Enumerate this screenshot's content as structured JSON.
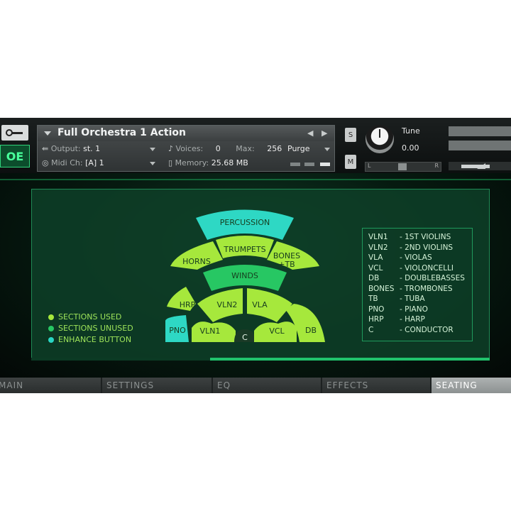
{
  "header": {
    "instrument_name": "Full Orchestra 1 Action",
    "output_label": "Output:",
    "output_value": "st. 1",
    "voices_label": "Voices:",
    "voices_value": "0",
    "max_label": "Max:",
    "max_value": "256",
    "purge_label": "Purge",
    "midi_label": "Midi Ch:",
    "midi_value": "[A]  1",
    "memory_label": "Memory:",
    "memory_value": "25.68 MB",
    "solo_label": "S",
    "mute_label": "M",
    "tune_label": "Tune",
    "tune_value": "0.00",
    "pan_left": "L",
    "pan_right": "R",
    "logo_text": "OE"
  },
  "seating": {
    "sections": {
      "percussion": "PERCUSSION",
      "horns": "HORNS",
      "trumpets": "TRUMPETS",
      "bones_line1": "BONES",
      "bones_line2": "+TB",
      "winds": "WINDS",
      "hrp": "HRP",
      "vln2": "VLN2",
      "vla": "VLA",
      "pno": "PNO",
      "vln1": "VLN1",
      "c": "C",
      "vcl": "VCL",
      "db": "DB"
    },
    "legend": [
      {
        "label": "SECTIONS USED",
        "color": "#a6e83c"
      },
      {
        "label": "SECTIONS UNUSED",
        "color": "#27c763"
      },
      {
        "label": "ENHANCE BUTTON",
        "color": "#2ad6c4"
      }
    ],
    "key": [
      {
        "abbr": "VLN1",
        "name": "- 1ST VIOLINS"
      },
      {
        "abbr": "VLN2",
        "name": "- 2ND VIOLINS"
      },
      {
        "abbr": "VLA",
        "name": "- VIOLAS"
      },
      {
        "abbr": "VCL",
        "name": "- VIOLONCELLI"
      },
      {
        "abbr": "DB",
        "name": "- DOUBLEBASSES"
      },
      {
        "abbr": "BONES",
        "name": "- TROMBONES"
      },
      {
        "abbr": "TB",
        "name": "- TUBA"
      },
      {
        "abbr": "PNO",
        "name": "- PIANO"
      },
      {
        "abbr": "HRP",
        "name": "- HARP"
      },
      {
        "abbr": "C",
        "name": "- CONDUCTOR"
      }
    ]
  },
  "tabs": [
    "MAIN",
    "SETTINGS",
    "EQ",
    "EFFECTS",
    "SEATING"
  ],
  "active_tab": "SEATING"
}
